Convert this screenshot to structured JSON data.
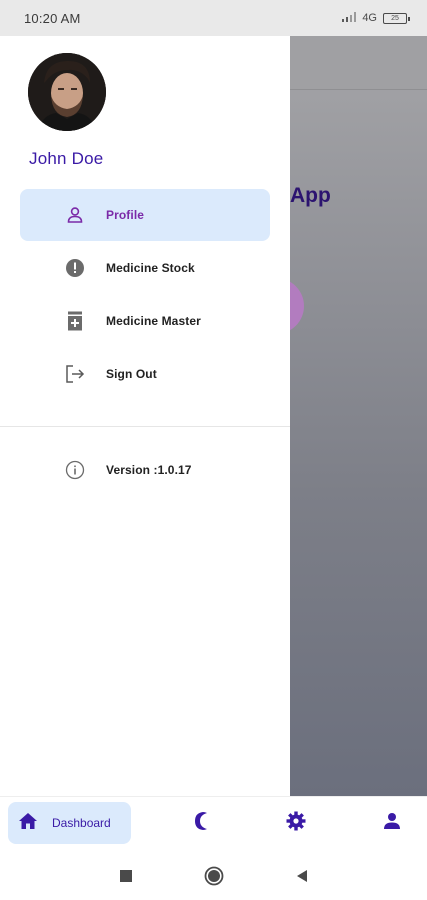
{
  "status_bar": {
    "time": "10:20 AM",
    "network": "4G",
    "battery": "25"
  },
  "background_app": {
    "title_fragment": "App"
  },
  "drawer": {
    "user_name": "John Doe",
    "avatar_icon": "user-photo",
    "menu": [
      {
        "label": "Profile",
        "icon": "person-outline-icon",
        "active": true
      },
      {
        "label": "Medicine Stock",
        "icon": "alert-circle-icon",
        "active": false
      },
      {
        "label": "Medicine Master",
        "icon": "medicine-box-icon",
        "active": false
      },
      {
        "label": "Sign Out",
        "icon": "logout-icon",
        "active": false
      }
    ],
    "version": "Version :1.0.17"
  },
  "bottom_nav": {
    "items": [
      {
        "label": "Dashboard",
        "icon": "home-icon",
        "active": true
      },
      {
        "label": "",
        "icon": "moon-icon",
        "active": false
      },
      {
        "label": "",
        "icon": "gear-icon",
        "active": false
      },
      {
        "label": "",
        "icon": "person-icon",
        "active": false
      }
    ]
  },
  "colors": {
    "accent": "#3a1aa6",
    "active_bg": "#dbeafc",
    "active_text": "#7b2aa8"
  }
}
